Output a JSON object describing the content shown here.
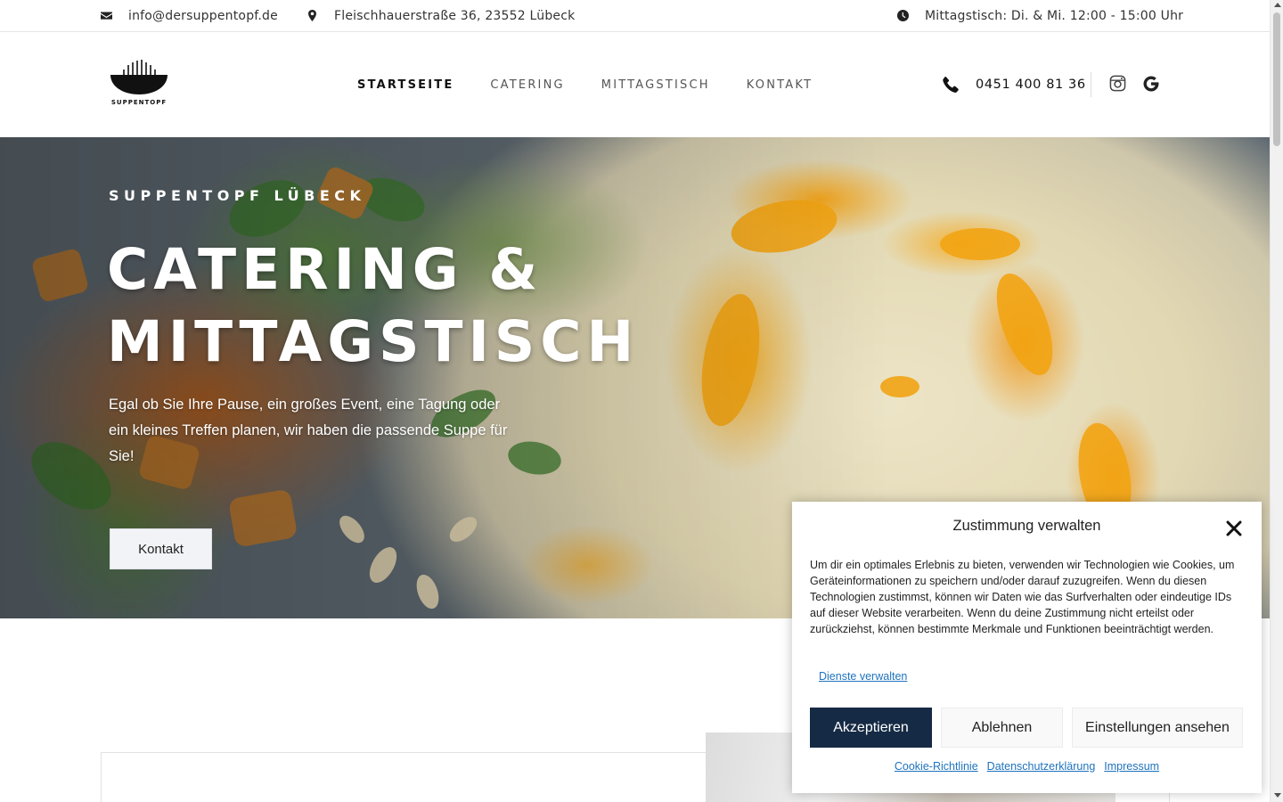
{
  "topbar": {
    "email": "info@dersuppentopf.de",
    "address": "Fleischhauerstraße 36, 23552 Lübeck",
    "hours": "Mittagstisch: Di. & Mi. 12:00 - 15:00 Uhr"
  },
  "header": {
    "logo_text": "SUPPENTOPF",
    "nav": [
      {
        "label": "STARTSEITE",
        "active": true
      },
      {
        "label": "CATERING",
        "active": false
      },
      {
        "label": "MITTAGSTISCH",
        "active": false
      },
      {
        "label": "KONTAKT",
        "active": false
      }
    ],
    "phone": "0451 400 81 36",
    "social_icons": [
      "instagram-icon",
      "google-icon"
    ]
  },
  "hero": {
    "eyebrow": "SUPPENTOPF LÜBECK",
    "title_line1": "CATERING &",
    "title_line2": "MITTAGSTISCH",
    "text": "Egal ob Sie Ihre Pause, ein großes Event, eine Tagung oder ein kleines Treffen planen, wir haben die passende Suppe für Sie!",
    "button_label": "Kontakt"
  },
  "cookie_modal": {
    "title": "Zustimmung verwalten",
    "body": "Um dir ein optimales Erlebnis zu bieten, verwenden wir Technologien wie Cookies, um Geräteinformationen zu speichern und/oder darauf zuzugreifen. Wenn du diesen Technologien zustimmst, können wir Daten wie das Surfverhalten oder eindeutige IDs auf dieser Website verarbeiten. Wenn du deine Zustimmung nicht erteilst oder zurückziehst, können bestimmte Merkmale und Funktionen beeinträchtigt werden.",
    "manage_link": "Dienste verwalten",
    "accept": "Akzeptieren",
    "deny": "Ablehnen",
    "preferences": "Einstellungen ansehen",
    "links": [
      "Cookie-Richtlinie",
      "Datenschutzerklärung",
      "Impressum"
    ]
  },
  "colors": {
    "accent_dark": "#152a44",
    "link": "#1e73be"
  }
}
